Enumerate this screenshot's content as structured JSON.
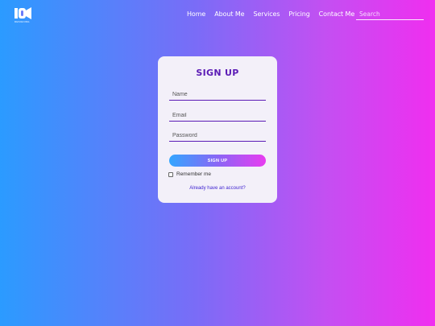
{
  "brand": {
    "logo_text": "DESIGNING"
  },
  "nav": {
    "links": [
      "Home",
      "About Me",
      "Services",
      "Pricing",
      "Contact Me"
    ],
    "search_placeholder": "Search"
  },
  "signup": {
    "title": "SIGN UP",
    "name_placeholder": "Name",
    "email_placeholder": "Email",
    "password_placeholder": "Password",
    "submit_label": "SIGN UP",
    "remember_label": "Remember me",
    "account_link": "Already have an account?"
  },
  "colors": {
    "accent": "#5b1bb5",
    "link": "#3b1fcf",
    "gradient_start": "#2b9bff",
    "gradient_end": "#f02ef0"
  }
}
